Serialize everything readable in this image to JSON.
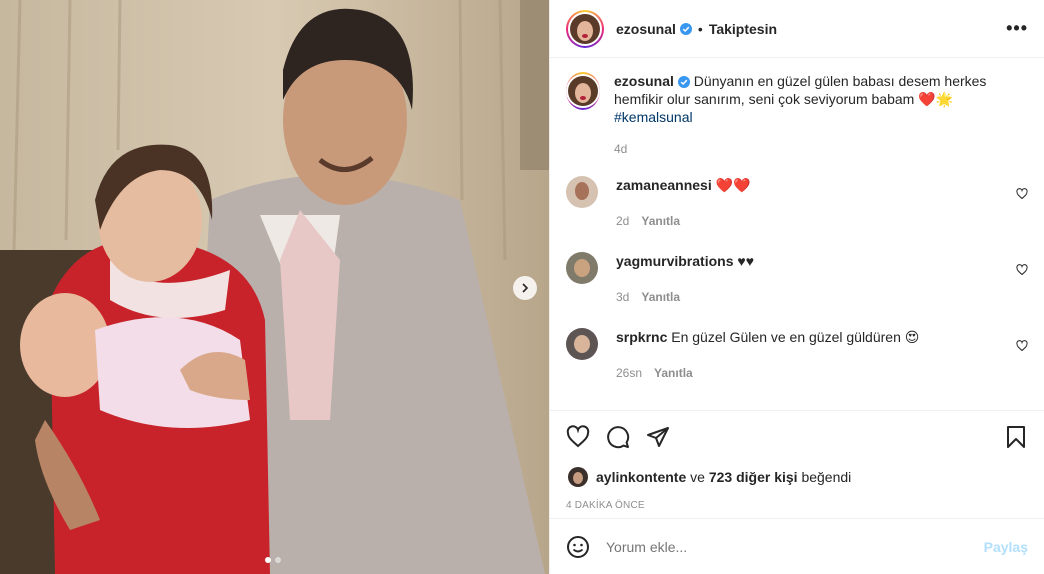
{
  "header": {
    "username": "ezosunal",
    "bullet": "•",
    "follow_status": "Takiptesin",
    "more_label": "•••"
  },
  "caption": {
    "username": "ezosunal",
    "text": "Dünyanın en güzel gülen babası desem herkes hemfikir olur sanırım, seni çok seviyorum babam ❤️🌟",
    "hashtag": "#kemalsunal",
    "time": "4d"
  },
  "comments": [
    {
      "username": "zamaneannesi",
      "text": "❤️❤️",
      "time": "2d",
      "reply": "Yanıtla"
    },
    {
      "username": "yagmurvibrations",
      "text": "♥♥",
      "time": "3d",
      "reply": "Yanıtla"
    },
    {
      "username": "srpkrnc",
      "text": "En güzel Gülen ve en güzel güldüren 😍",
      "time": "26sn",
      "reply": "Yanıtla"
    }
  ],
  "likes": {
    "user": "aylinkontente",
    "connector": "ve",
    "others": "723 diğer kişi",
    "suffix": "beğendi"
  },
  "timestamp": "4 DAKİKA ÖNCE",
  "add_comment": {
    "placeholder": "Yorum ekle...",
    "post_label": "Paylaş"
  },
  "colors": {
    "verified": "#3897f0",
    "hashtag": "#00376b",
    "post_disabled": "#b2dffc",
    "muted": "#8e8e8e"
  },
  "icons": [
    "verified-icon",
    "more-icon",
    "heart-icon",
    "comment-icon",
    "share-icon",
    "bookmark-icon",
    "emoji-icon",
    "chevron-right-icon"
  ]
}
